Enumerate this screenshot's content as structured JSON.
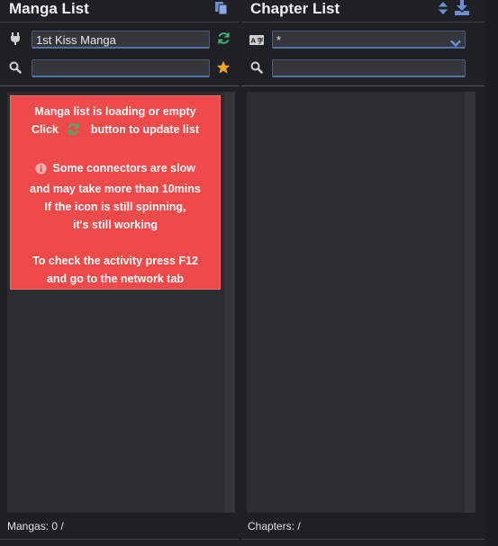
{
  "manga_panel": {
    "title": "Manga List",
    "connector_value": "1st Kiss Manga",
    "search_value": "",
    "footer": "Mangas: 0 /",
    "notice": {
      "line1": "Manga list is loading or empty",
      "line2_pre": "Click",
      "line2_post": "button to update list",
      "line3": "Some connectors are slow",
      "line4": "and may take more than 10mins",
      "line5": "If the icon is still spinning,",
      "line6": "it's still working",
      "line7": "To check the activity press F12",
      "line8": "and go to the network tab"
    }
  },
  "chapter_panel": {
    "title": "Chapter List",
    "language_value": "*",
    "search_value": "",
    "footer": "Chapters: /"
  },
  "colors": {
    "accent_blue": "#6c8fd6",
    "refresh_green": "#3cb371",
    "star_orange": "#f5a623",
    "notice_red": "#ee4a4a"
  },
  "icons": [
    "copy-icon",
    "sort-icon",
    "download-icon",
    "plug-icon",
    "refresh-icon",
    "search-icon",
    "star-icon",
    "language-icon",
    "chevron-down-icon",
    "info-icon"
  ]
}
